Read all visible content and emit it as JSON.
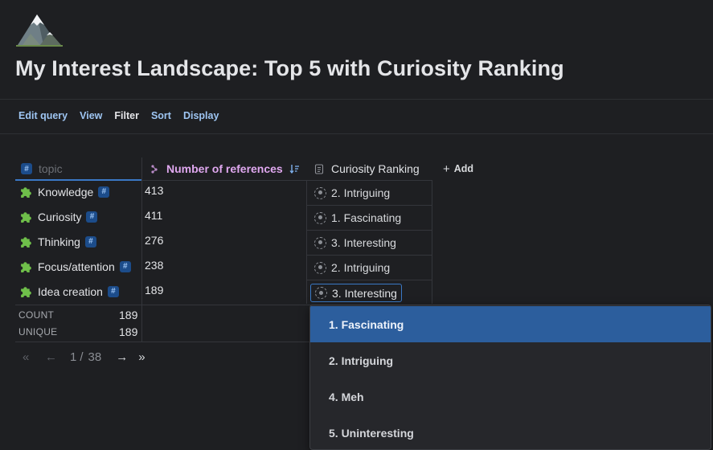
{
  "page": {
    "icon": "mountain-icon",
    "title": "My Interest Landscape: Top 5 with Curiosity Ranking"
  },
  "toolbar": {
    "edit_query": "Edit query",
    "view": "View",
    "filter": "Filter",
    "sort": "Sort",
    "display": "Display"
  },
  "table": {
    "columns": {
      "topic": "topic",
      "references": "Number of references",
      "ranking": "Curiosity Ranking",
      "add": "Add"
    },
    "rows": [
      {
        "topic": "Knowledge",
        "refs": "413",
        "ranking": "2. Intriguing"
      },
      {
        "topic": "Curiosity",
        "refs": "411",
        "ranking": "1. Fascinating"
      },
      {
        "topic": "Thinking",
        "refs": "276",
        "ranking": "3. Interesting"
      },
      {
        "topic": "Focus/attention",
        "refs": "238",
        "ranking": "2. Intriguing"
      },
      {
        "topic": "Idea creation",
        "refs": "189",
        "ranking": "3. Interesting"
      }
    ],
    "footer": {
      "count_label": "COUNT",
      "count_value": "189",
      "unique_label": "UNIQUE",
      "unique_value": "189"
    }
  },
  "pager": {
    "first": "«",
    "prev": "←",
    "current": "1",
    "separator": "/",
    "total": "38",
    "next": "→",
    "last": "»"
  },
  "dropdown": {
    "options": [
      "1. Fascinating",
      "2. Intriguing",
      "4. Meh",
      "5. Uninteresting"
    ],
    "selected": "1. Fascinating"
  },
  "colors": {
    "background": "#1e1f22",
    "link": "#9ec5f2",
    "sorted_header": "#e0a8f0",
    "selected_option": "#2c5e9d",
    "tag_chip": "#1c4c8a"
  }
}
